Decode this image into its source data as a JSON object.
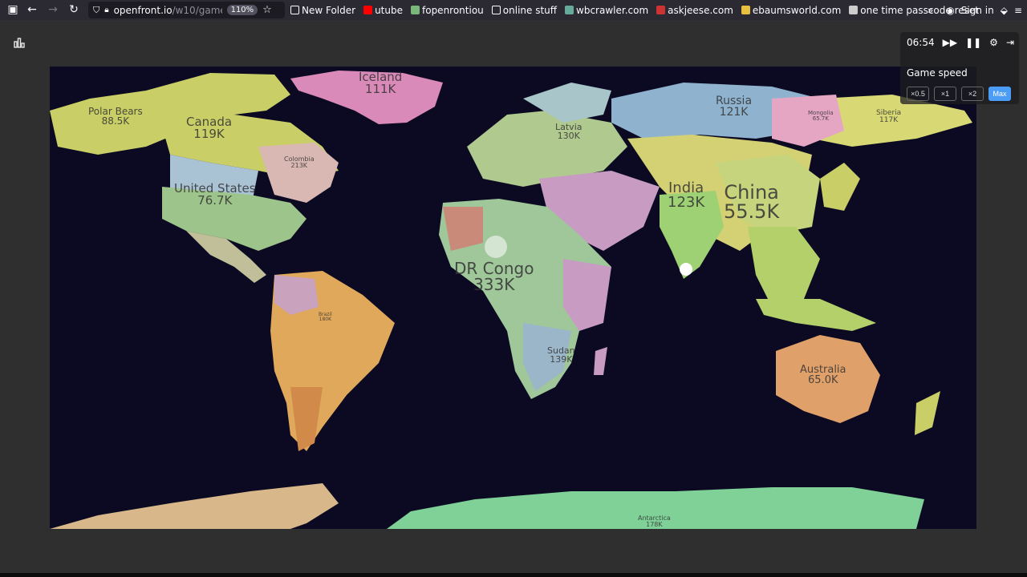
{
  "browser": {
    "url_host": "openfront.io",
    "url_path": "/w10/game/",
    "zoom": "110%",
    "bookmarks": [
      {
        "label": "New Folder",
        "icon": "folder-icon",
        "color": "#fbfbfe"
      },
      {
        "label": "utube",
        "icon": "youtube-icon",
        "color": "#ff0000"
      },
      {
        "label": "fopenrontiou",
        "icon": "globe-icon",
        "color": "#7ab57a"
      },
      {
        "label": "online stuff",
        "icon": "folder-icon",
        "color": "#fbfbfe"
      },
      {
        "label": "wbcrawler.com",
        "icon": "site-icon",
        "color": "#6a9"
      },
      {
        "label": "askjeese.com",
        "icon": "site-icon",
        "color": "#c33"
      },
      {
        "label": "ebaumsworld.com",
        "icon": "site-icon",
        "color": "#e8c040"
      },
      {
        "label": "one time passcode reset",
        "icon": "site-icon",
        "color": "#ccc"
      }
    ],
    "sign_in": "Sign in"
  },
  "hud": {
    "timer": "06:54",
    "speed_title": "Game speed",
    "speeds": [
      "×0.5",
      "×1",
      "×2",
      "Max"
    ],
    "active_speed": "Max",
    "accent": "#4b9cf5"
  },
  "map": {
    "background": "#0b0a22",
    "labels": [
      {
        "name": "Iceland",
        "value": "111K"
      },
      {
        "name": "Polar Bears",
        "value": "88.5K"
      },
      {
        "name": "Canada",
        "value": "119K"
      },
      {
        "name": "United States",
        "value": "76.7K"
      },
      {
        "name": "Russia",
        "value": "121K"
      },
      {
        "name": "Latvia",
        "value": "130K"
      },
      {
        "name": "India",
        "value": "123K"
      },
      {
        "name": "China",
        "value": "55.5K"
      },
      {
        "name": "DR Congo",
        "value": "333K"
      },
      {
        "name": "Sudan",
        "value": "139K"
      },
      {
        "name": "Australia",
        "value": "65.0K"
      },
      {
        "name": "Siberia",
        "value": "117K"
      },
      {
        "name": "Mongolia",
        "value": "65.7K"
      },
      {
        "name": "Colombia",
        "value": "213K"
      },
      {
        "name": "Brazil",
        "value": "180K"
      },
      {
        "name": "Antarctica",
        "value": "178K"
      }
    ]
  }
}
